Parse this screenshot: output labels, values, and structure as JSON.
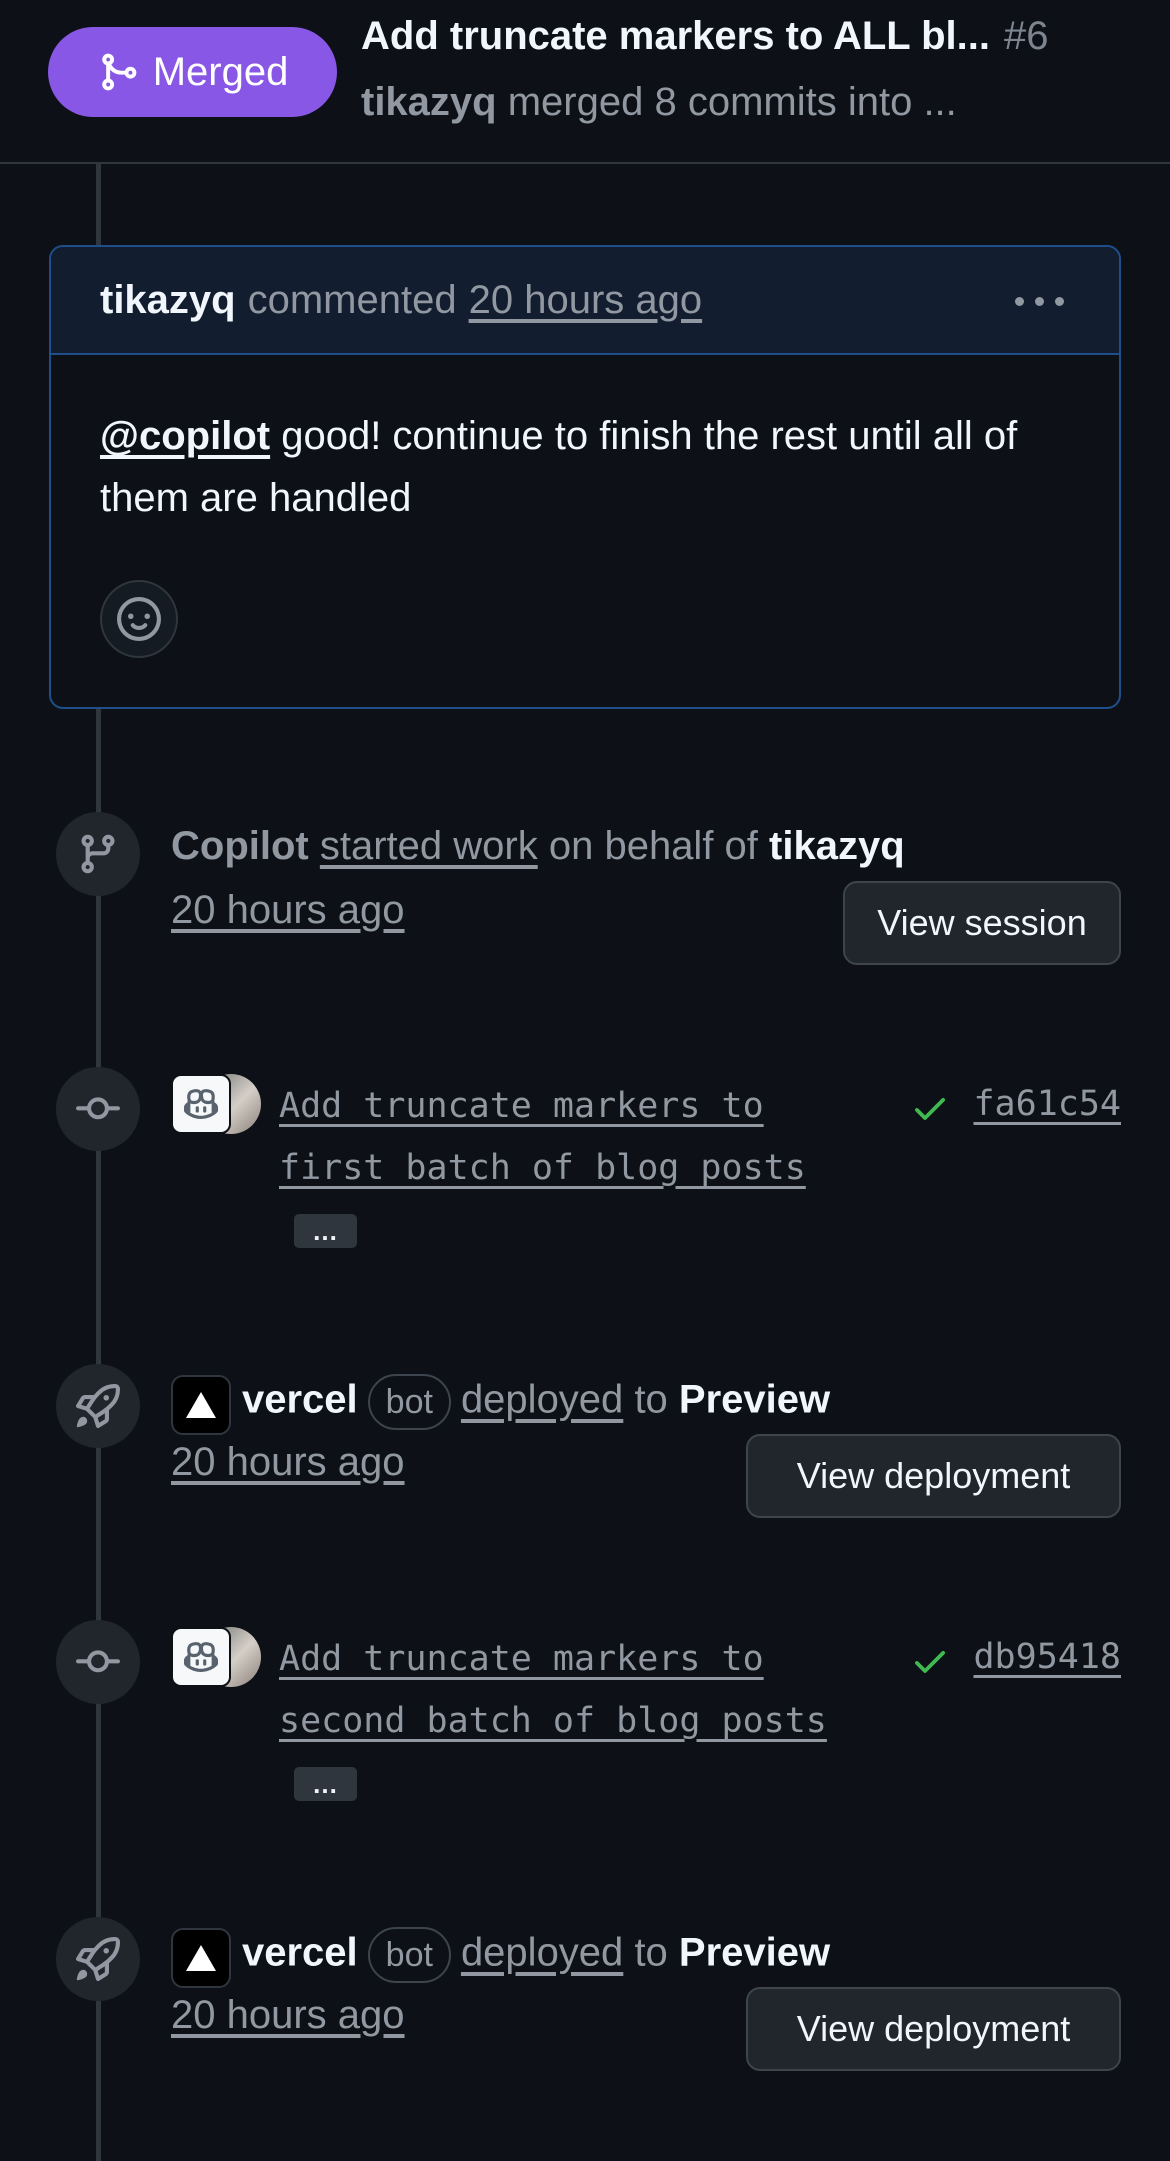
{
  "header": {
    "badge_label": "Merged",
    "title": "Add truncate markers to ALL bl...",
    "number": "#6",
    "merger": "tikazyq",
    "subtitle_rest": "merged 8 commits into ..."
  },
  "comment": {
    "author": "tikazyq",
    "action": "commented",
    "time": "20 hours ago",
    "mention": "@copilot",
    "body": " good! continue to finish the rest until all of them are handled"
  },
  "session_event": {
    "actor": "Copilot",
    "action": "started work",
    "middle": "on behalf of",
    "behalf": "tikazyq",
    "time": "20 hours ago",
    "button": "View session"
  },
  "commits": [
    {
      "line1": "Add truncate markers to",
      "line2": "first batch of blog posts",
      "more": "...",
      "sha": "fa61c54",
      "status_color": "#3fb950"
    },
    {
      "line1": "Add truncate markers to",
      "line2": "second batch of blog posts",
      "more": "...",
      "sha": "db95418",
      "status_color": "#3fb950"
    }
  ],
  "deployments": [
    {
      "actor": "vercel",
      "badge": "bot",
      "action": "deployed",
      "to": "to",
      "env": "Preview",
      "time": "20 hours ago",
      "button": "View deployment"
    },
    {
      "actor": "vercel",
      "badge": "bot",
      "action": "deployed",
      "to": "to",
      "env": "Preview",
      "time": "20 hours ago",
      "button": "View deployment"
    }
  ],
  "colors": {
    "merged": "#8957e5",
    "background": "#0d1117",
    "comment_border": "#1f4f8a",
    "success": "#3fb950"
  },
  "icons": [
    "git-merge-icon",
    "kebab-horizontal-icon",
    "smiley-icon",
    "git-branch-icon",
    "git-commit-icon",
    "rocket-icon",
    "check-icon",
    "copilot-icon",
    "vercel-triangle-icon"
  ]
}
